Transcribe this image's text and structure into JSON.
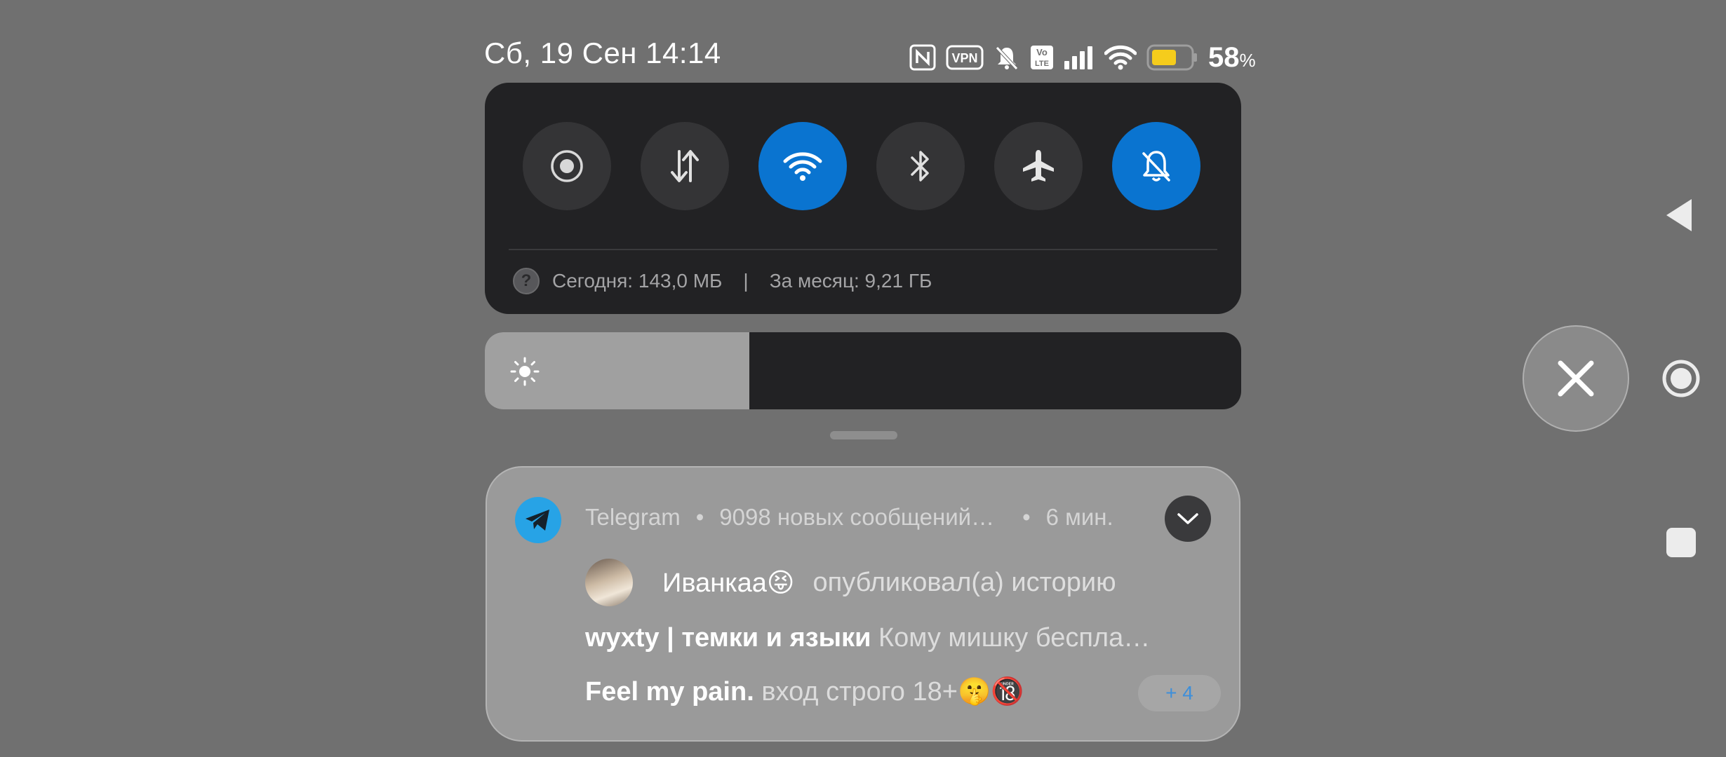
{
  "status_bar": {
    "time": "Сб, 19 Сен 14:14",
    "battery_percent": "58",
    "battery_unit": "%",
    "battery_level": 0.58,
    "icons": [
      "nfc-icon",
      "vpn-icon",
      "mute-icon",
      "volte-icon",
      "signal-icon",
      "wifi-icon",
      "battery-icon"
    ],
    "vpn_label": "VPN",
    "volte_label_top": "Vo",
    "volte_label_bottom": "LTE"
  },
  "quick_settings": {
    "tiles": [
      {
        "name": "screen-record",
        "icon": "record-icon",
        "active": false
      },
      {
        "name": "mobile-data",
        "icon": "data-arrows-icon",
        "active": false
      },
      {
        "name": "wifi",
        "icon": "wifi-icon",
        "active": true
      },
      {
        "name": "bluetooth",
        "icon": "bluetooth-icon",
        "active": false
      },
      {
        "name": "airplane",
        "icon": "airplane-icon",
        "active": false
      },
      {
        "name": "silent",
        "icon": "bell-off-icon",
        "active": true
      }
    ],
    "accent_color": "#0a74d0",
    "help_glyph": "?",
    "usage_today": "Сегодня: 143,0 МБ",
    "separator": "|",
    "usage_month": "За месяц: 9,21 ГБ"
  },
  "brightness": {
    "level": 0.35,
    "icon": "sun-icon"
  },
  "notification": {
    "app_name": "Telegram",
    "bullet": "•",
    "summary": "9098 новых сообщений…",
    "time_ago": "6 мин.",
    "messages": [
      {
        "sender": "Иванкаа😝",
        "text": "опубликовал(а) историю"
      },
      {
        "sender": "wyxty | темки и языки",
        "text": "Кому мишку беспла…"
      },
      {
        "sender": "Feel my pain.",
        "text": "вход строго 18+🤫🔞"
      }
    ],
    "more_count": "+ 4"
  },
  "navigation": {
    "buttons": [
      "back-icon",
      "home-icon",
      "recents-icon",
      "close-icon"
    ]
  }
}
